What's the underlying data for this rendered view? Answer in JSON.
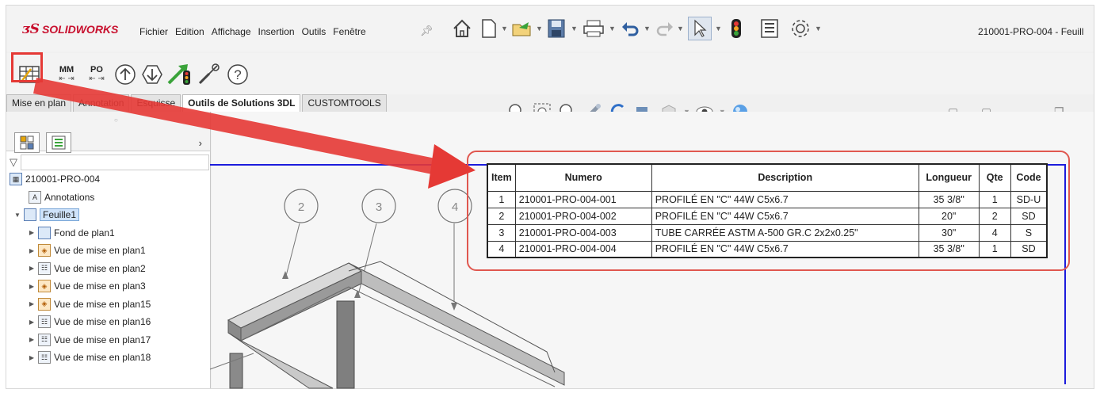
{
  "app": {
    "logo_ds": "ᴣS",
    "logo_text": "SOLIDWORKS",
    "document_title": "210001-PRO-004 - Feuill"
  },
  "menu": [
    "Fichier",
    "Edition",
    "Affichage",
    "Insertion",
    "Outils",
    "Fenêtre"
  ],
  "custom_toolbar": {
    "mm_label": "MM",
    "po_label": "PO",
    "arrows": "⇤ ⇥"
  },
  "tabs": [
    "Mise en plan",
    "Annotation",
    "Esquisse",
    "Outils de Solutions 3DL",
    "CUSTOMTOOLS"
  ],
  "active_tab": "Outils de Solutions 3DL",
  "feature_tree": {
    "root": "210001-PRO-004",
    "annotations": "Annotations",
    "sheet": "Feuille1",
    "children": [
      "Fond de plan1",
      "Vue de mise en plan1",
      "Vue de mise en plan2",
      "Vue de mise en plan3",
      "Vue de mise en plan15",
      "Vue de mise en plan16",
      "Vue de mise en plan17",
      "Vue de mise en plan18"
    ]
  },
  "balloons": [
    "2",
    "3",
    "4"
  ],
  "bom": {
    "headers": {
      "item": "Item",
      "numero": "Numero",
      "description": "Description",
      "longueur": "Longueur",
      "qte": "Qte",
      "code": "Code"
    },
    "rows": [
      {
        "item": "1",
        "numero": "210001-PRO-004-001",
        "description": "PROFILÉ EN \"C\" 44W C5x6.7",
        "longueur": "35 3/8\"",
        "qte": "1",
        "code": "SD-U"
      },
      {
        "item": "2",
        "numero": "210001-PRO-004-002",
        "description": "PROFILÉ EN \"C\" 44W C5x6.7",
        "longueur": "20\"",
        "qte": "2",
        "code": "SD"
      },
      {
        "item": "3",
        "numero": "210001-PRO-004-003",
        "description": "TUBE CARRÉE ASTM A-500 GR.C 2x2x0.25\"",
        "longueur": "30\"",
        "qte": "4",
        "code": "S"
      },
      {
        "item": "4",
        "numero": "210001-PRO-004-004",
        "description": "PROFILÉ EN \"C\" 44W C5x6.7",
        "longueur": "35 3/8\"",
        "qte": "1",
        "code": "SD"
      }
    ]
  },
  "colors": {
    "highlight": "#e53935",
    "sheet_border": "#1c1cdc",
    "brand": "#c8102e"
  }
}
